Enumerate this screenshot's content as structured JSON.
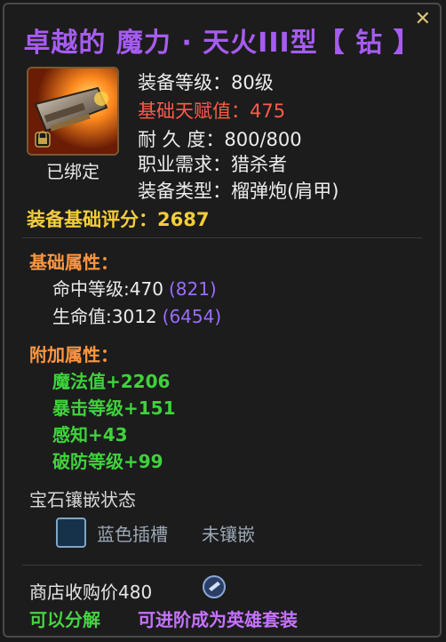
{
  "title": "卓越的 魔力 · 天火III型【 钻 】",
  "close_symbol": "✕",
  "item": {
    "icon": "flamethrower-shoulder-armor-icon",
    "bound_label": "已绑定",
    "info": [
      {
        "label": "装备等级：",
        "value": "80级"
      },
      {
        "label": "基础天赋值：",
        "value": "475"
      },
      {
        "label": "耐 久 度：",
        "value": "800/800"
      },
      {
        "label": "职业需求：",
        "value": "猎杀者"
      },
      {
        "label": "装备类型：",
        "value": "榴弹炮(肩甲)"
      }
    ],
    "score_label": "装备基础评分：",
    "score_value": "2687"
  },
  "base_attrs": {
    "title": "基础属性：",
    "rows": [
      {
        "label": "命中等级:",
        "value": "470",
        "extra": "(821)"
      },
      {
        "label": "生命值:",
        "value": "3012",
        "extra": "(6454)"
      }
    ]
  },
  "extra_attrs": {
    "title": "附加属性：",
    "rows": [
      "魔法值+2206",
      "暴击等级+151",
      "感知+43",
      "破防等级+99"
    ]
  },
  "gem": {
    "title": "宝石镶嵌状态",
    "slot_label": "蓝色插槽",
    "status": "未镶嵌"
  },
  "footer": {
    "price_label": "商店收购价480",
    "can_decompose": "可以分解",
    "can_upgrade": "可进阶成为英雄套装"
  },
  "colors": {
    "title": "#a65cf2",
    "talent": "#ff5a4a",
    "score": "#f2cd3c",
    "section": "#ff9640",
    "bonus": "#3fd23c",
    "extra_paren": "#9b6cff"
  }
}
